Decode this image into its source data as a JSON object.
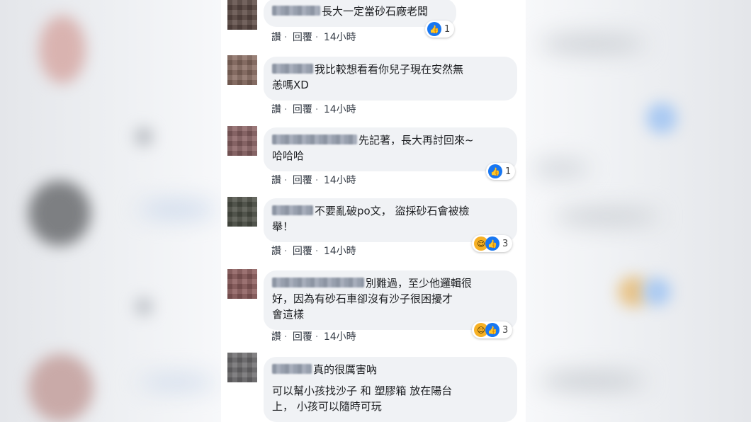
{
  "colors": {
    "bubble": "#f0f2f5",
    "like": "#1877f2",
    "haha": "#f7b125",
    "text": "#1c1e21"
  },
  "comments": [
    {
      "text": "長大一定當砂石廠老闆",
      "actions": {
        "like": "讚",
        "reply": "回覆",
        "time": "14小時"
      },
      "reactions": {
        "icons": [
          "like-icon"
        ],
        "count": "1"
      }
    },
    {
      "text_line1": "我比較想看看你兒子現在安然無",
      "text_line2": "恙嗎XD",
      "actions": {
        "like": "讚",
        "reply": "回覆",
        "time": "14小時"
      }
    },
    {
      "text_line1": "先記著，長大再討回來~",
      "text_line2": "哈哈哈",
      "actions": {
        "like": "讚",
        "reply": "回覆",
        "time": "14小時"
      },
      "reactions": {
        "icons": [
          "like-icon"
        ],
        "count": "1"
      }
    },
    {
      "text_line1": "不要亂破po文， 盜採砂石會被檢",
      "text_line2": "舉！",
      "actions": {
        "like": "讚",
        "reply": "回覆",
        "time": "14小時"
      },
      "reactions": {
        "icons": [
          "haha-icon",
          "like-icon"
        ],
        "count": "3"
      }
    },
    {
      "text_line1": "別難過，至少他邏輯很",
      "text_line2": "好，因為有砂石車卻沒有沙子很困擾才",
      "text_line3": "會這樣",
      "actions": {
        "like": "讚",
        "reply": "回覆",
        "time": "14小時"
      },
      "reactions": {
        "icons": [
          "haha-icon",
          "like-icon"
        ],
        "count": "3"
      }
    },
    {
      "text_line1": "真的很厲害吶",
      "text_line2": "可以幫小孩找沙子 和 塑膠箱 放在陽台",
      "text_line3": "上， 小孩可以隨時可玩"
    }
  ]
}
